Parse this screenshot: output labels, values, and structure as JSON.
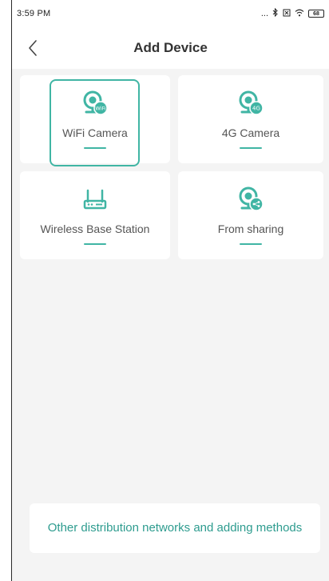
{
  "status_bar": {
    "time": "3:59 PM",
    "signal_dots": "...",
    "battery_label": "68"
  },
  "nav": {
    "title": "Add Device"
  },
  "cards": [
    {
      "label": "WiFi Camera",
      "icon": "wifi-camera-icon",
      "badge": "WiFi"
    },
    {
      "label": "4G Camera",
      "icon": "4g-camera-icon",
      "badge": "4G"
    },
    {
      "label": "Wireless Base Station",
      "icon": "base-station-icon"
    },
    {
      "label": "From sharing",
      "icon": "share-camera-icon"
    }
  ],
  "selected_card": "WiFi Camera",
  "bottom_button": {
    "label": "Other distribution networks and adding methods"
  },
  "colors": {
    "accent": "#40b5a4",
    "accent_text": "#2e9c8f",
    "background": "#f4f4f4",
    "card": "#ffffff",
    "title": "#333333"
  }
}
